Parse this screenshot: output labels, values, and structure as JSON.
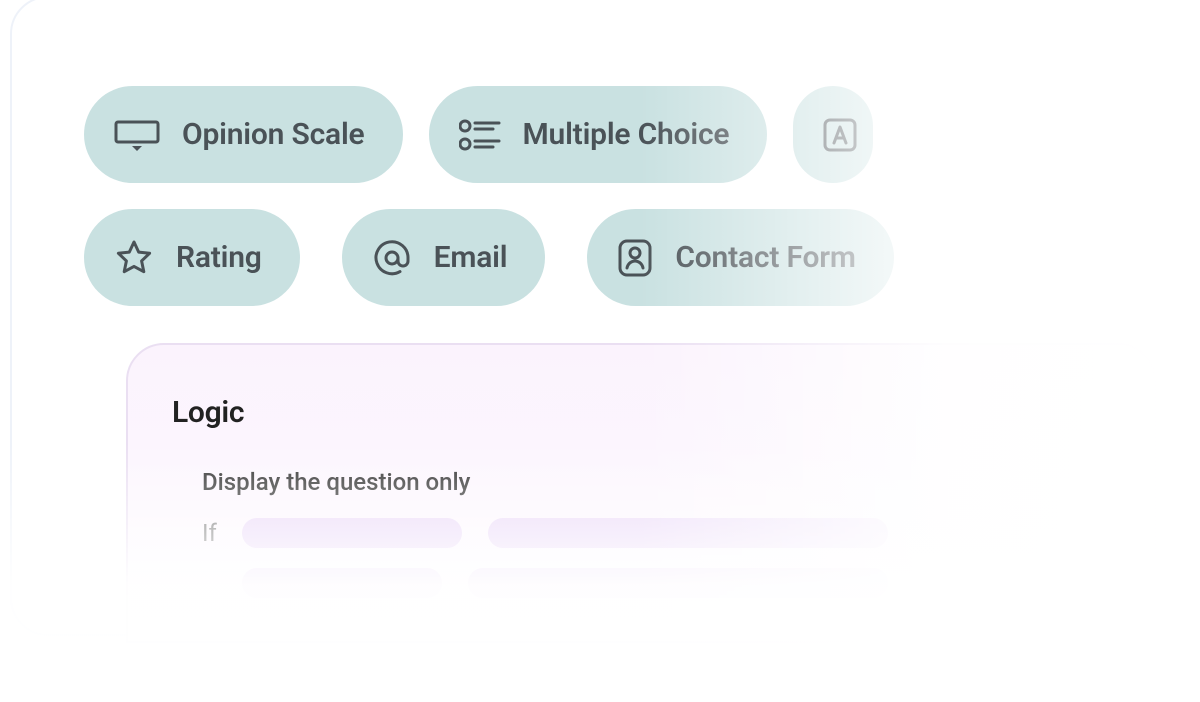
{
  "chips_row1": [
    {
      "key": "opinion-scale",
      "label": "Opinion Scale",
      "icon": "opinion-scale-icon"
    },
    {
      "key": "multiple-choice",
      "label": "Multiple Choice",
      "icon": "multiple-choice-icon"
    }
  ],
  "chips_row2": [
    {
      "key": "rating",
      "label": "Rating",
      "icon": "star-icon"
    },
    {
      "key": "email",
      "label": "Email",
      "icon": "at-sign-icon"
    },
    {
      "key": "contact-form",
      "label": "Contact Form",
      "icon": "contact-icon"
    }
  ],
  "logic": {
    "title": "Logic",
    "subtitle": "Display the question only",
    "if_label": "If"
  },
  "colors": {
    "chip_bg": "#c9e1e1",
    "chip_text": "#4a5257",
    "logic_bg": "#fbf3fd",
    "logic_border": "#eadff2",
    "pill": "#e8d4f7"
  }
}
